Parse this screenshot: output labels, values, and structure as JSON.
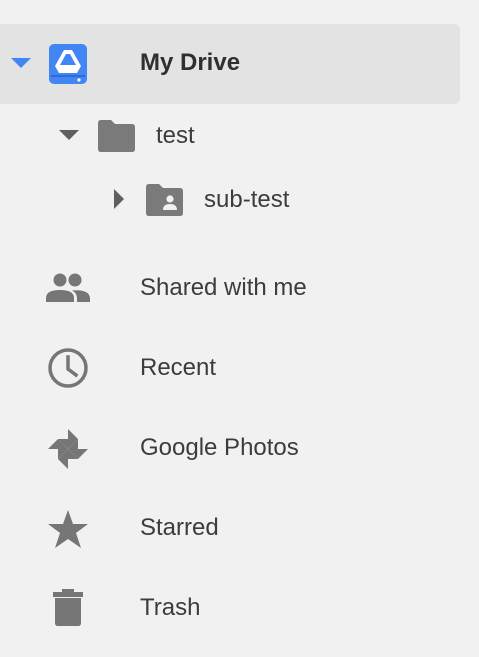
{
  "nav": {
    "my_drive": {
      "label": "My Drive",
      "expanded": true,
      "selected": true,
      "icon": "drive-icon",
      "toggle_icon": "caret-down-icon",
      "accent": "#4285f4"
    },
    "folders": [
      {
        "label": "test",
        "icon": "folder-icon",
        "toggle_icon": "caret-down-icon",
        "expanded": true
      },
      {
        "label": "sub-test",
        "icon": "shared-folder-icon",
        "toggle_icon": "caret-right-icon",
        "expanded": false
      }
    ],
    "items": [
      {
        "label": "Shared with me",
        "icon": "people-icon"
      },
      {
        "label": "Recent",
        "icon": "clock-icon"
      },
      {
        "label": "Google Photos",
        "icon": "pinwheel-icon"
      },
      {
        "label": "Starred",
        "icon": "star-icon"
      },
      {
        "label": "Trash",
        "icon": "trash-icon"
      }
    ]
  },
  "colors": {
    "background": "#f1f1f1",
    "selected_background": "#e3e3e3",
    "icon_gray": "#767676",
    "text": "#3c3c3c"
  }
}
